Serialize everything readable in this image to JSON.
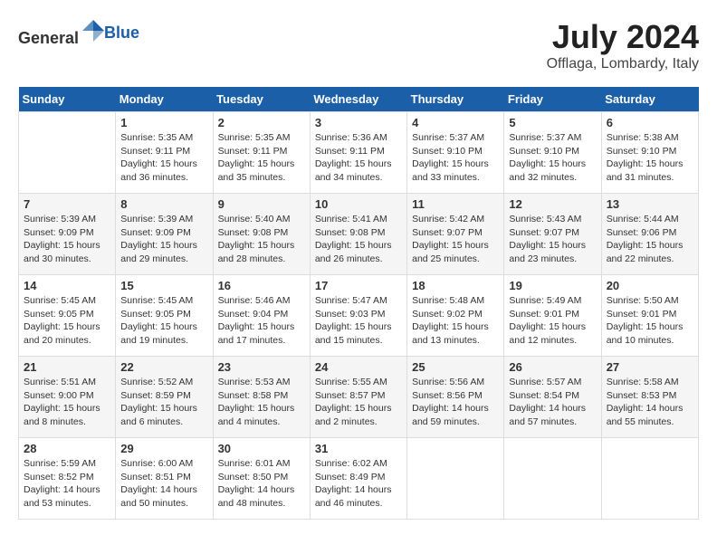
{
  "header": {
    "logo_general": "General",
    "logo_blue": "Blue",
    "month_year": "July 2024",
    "location": "Offlaga, Lombardy, Italy"
  },
  "calendar": {
    "days_of_week": [
      "Sunday",
      "Monday",
      "Tuesday",
      "Wednesday",
      "Thursday",
      "Friday",
      "Saturday"
    ],
    "weeks": [
      [
        {
          "day": "",
          "info": ""
        },
        {
          "day": "1",
          "info": "Sunrise: 5:35 AM\nSunset: 9:11 PM\nDaylight: 15 hours\nand 36 minutes."
        },
        {
          "day": "2",
          "info": "Sunrise: 5:35 AM\nSunset: 9:11 PM\nDaylight: 15 hours\nand 35 minutes."
        },
        {
          "day": "3",
          "info": "Sunrise: 5:36 AM\nSunset: 9:11 PM\nDaylight: 15 hours\nand 34 minutes."
        },
        {
          "day": "4",
          "info": "Sunrise: 5:37 AM\nSunset: 9:10 PM\nDaylight: 15 hours\nand 33 minutes."
        },
        {
          "day": "5",
          "info": "Sunrise: 5:37 AM\nSunset: 9:10 PM\nDaylight: 15 hours\nand 32 minutes."
        },
        {
          "day": "6",
          "info": "Sunrise: 5:38 AM\nSunset: 9:10 PM\nDaylight: 15 hours\nand 31 minutes."
        }
      ],
      [
        {
          "day": "7",
          "info": "Sunrise: 5:39 AM\nSunset: 9:09 PM\nDaylight: 15 hours\nand 30 minutes."
        },
        {
          "day": "8",
          "info": "Sunrise: 5:39 AM\nSunset: 9:09 PM\nDaylight: 15 hours\nand 29 minutes."
        },
        {
          "day": "9",
          "info": "Sunrise: 5:40 AM\nSunset: 9:08 PM\nDaylight: 15 hours\nand 28 minutes."
        },
        {
          "day": "10",
          "info": "Sunrise: 5:41 AM\nSunset: 9:08 PM\nDaylight: 15 hours\nand 26 minutes."
        },
        {
          "day": "11",
          "info": "Sunrise: 5:42 AM\nSunset: 9:07 PM\nDaylight: 15 hours\nand 25 minutes."
        },
        {
          "day": "12",
          "info": "Sunrise: 5:43 AM\nSunset: 9:07 PM\nDaylight: 15 hours\nand 23 minutes."
        },
        {
          "day": "13",
          "info": "Sunrise: 5:44 AM\nSunset: 9:06 PM\nDaylight: 15 hours\nand 22 minutes."
        }
      ],
      [
        {
          "day": "14",
          "info": "Sunrise: 5:45 AM\nSunset: 9:05 PM\nDaylight: 15 hours\nand 20 minutes."
        },
        {
          "day": "15",
          "info": "Sunrise: 5:45 AM\nSunset: 9:05 PM\nDaylight: 15 hours\nand 19 minutes."
        },
        {
          "day": "16",
          "info": "Sunrise: 5:46 AM\nSunset: 9:04 PM\nDaylight: 15 hours\nand 17 minutes."
        },
        {
          "day": "17",
          "info": "Sunrise: 5:47 AM\nSunset: 9:03 PM\nDaylight: 15 hours\nand 15 minutes."
        },
        {
          "day": "18",
          "info": "Sunrise: 5:48 AM\nSunset: 9:02 PM\nDaylight: 15 hours\nand 13 minutes."
        },
        {
          "day": "19",
          "info": "Sunrise: 5:49 AM\nSunset: 9:01 PM\nDaylight: 15 hours\nand 12 minutes."
        },
        {
          "day": "20",
          "info": "Sunrise: 5:50 AM\nSunset: 9:01 PM\nDaylight: 15 hours\nand 10 minutes."
        }
      ],
      [
        {
          "day": "21",
          "info": "Sunrise: 5:51 AM\nSunset: 9:00 PM\nDaylight: 15 hours\nand 8 minutes."
        },
        {
          "day": "22",
          "info": "Sunrise: 5:52 AM\nSunset: 8:59 PM\nDaylight: 15 hours\nand 6 minutes."
        },
        {
          "day": "23",
          "info": "Sunrise: 5:53 AM\nSunset: 8:58 PM\nDaylight: 15 hours\nand 4 minutes."
        },
        {
          "day": "24",
          "info": "Sunrise: 5:55 AM\nSunset: 8:57 PM\nDaylight: 15 hours\nand 2 minutes."
        },
        {
          "day": "25",
          "info": "Sunrise: 5:56 AM\nSunset: 8:56 PM\nDaylight: 14 hours\nand 59 minutes."
        },
        {
          "day": "26",
          "info": "Sunrise: 5:57 AM\nSunset: 8:54 PM\nDaylight: 14 hours\nand 57 minutes."
        },
        {
          "day": "27",
          "info": "Sunrise: 5:58 AM\nSunset: 8:53 PM\nDaylight: 14 hours\nand 55 minutes."
        }
      ],
      [
        {
          "day": "28",
          "info": "Sunrise: 5:59 AM\nSunset: 8:52 PM\nDaylight: 14 hours\nand 53 minutes."
        },
        {
          "day": "29",
          "info": "Sunrise: 6:00 AM\nSunset: 8:51 PM\nDaylight: 14 hours\nand 50 minutes."
        },
        {
          "day": "30",
          "info": "Sunrise: 6:01 AM\nSunset: 8:50 PM\nDaylight: 14 hours\nand 48 minutes."
        },
        {
          "day": "31",
          "info": "Sunrise: 6:02 AM\nSunset: 8:49 PM\nDaylight: 14 hours\nand 46 minutes."
        },
        {
          "day": "",
          "info": ""
        },
        {
          "day": "",
          "info": ""
        },
        {
          "day": "",
          "info": ""
        }
      ]
    ]
  }
}
